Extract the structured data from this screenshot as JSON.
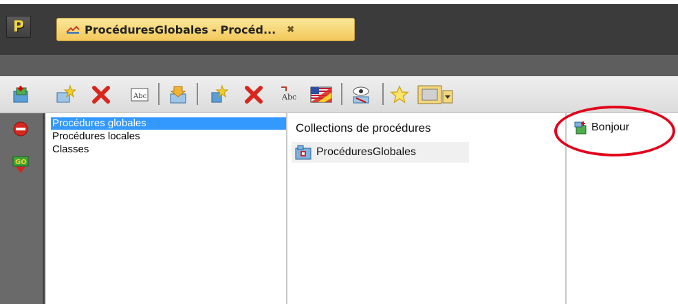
{
  "app": {
    "logo_letter": "P",
    "logo_icon": "p-logo-icon"
  },
  "tab": {
    "title": "ProcéduresGlobales - Procéd...",
    "close_glyph": "✖",
    "icon": "procedures-tab-icon"
  },
  "toolbar": {
    "icons": [
      "new-collection-icon",
      "new-star-icon",
      "delete-icon",
      "rename-icon",
      "import-icon",
      "new-procedure-icon",
      "delete-procedure-icon",
      "rename-procedure-icon",
      "language-flag-icon",
      "view-icon",
      "favorite-icon",
      "color-picker-icon"
    ]
  },
  "leftstrip": {
    "icons": [
      "stop-icon",
      "go-icon"
    ]
  },
  "categories": {
    "items": [
      "Procédures globales",
      "Procédures locales",
      "Classes"
    ],
    "selected_index": 0
  },
  "collections": {
    "header": "Collections de procédures",
    "items": [
      "ProcéduresGlobales"
    ]
  },
  "procedures": {
    "items": [
      "Bonjour"
    ]
  },
  "colors": {
    "highlight": "#3399ff",
    "annotation": "#e3001b",
    "tab": "#f2c85a"
  }
}
